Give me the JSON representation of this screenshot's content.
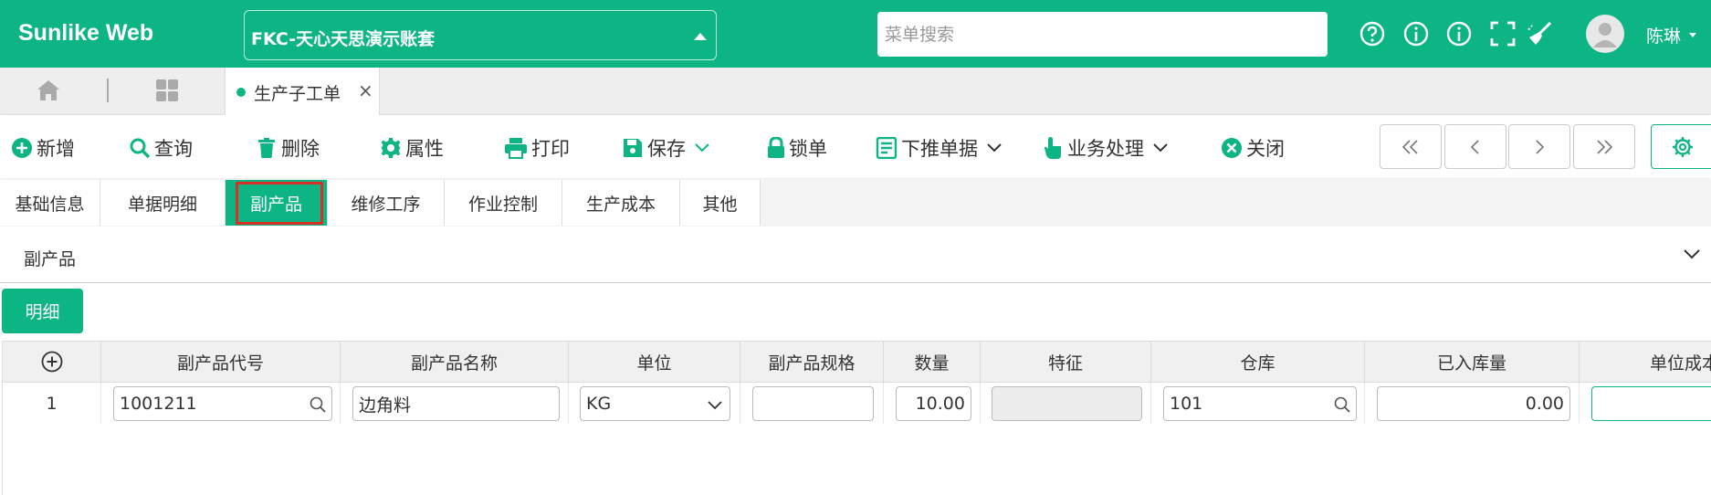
{
  "header": {
    "brand": "Sunlike Web",
    "account": "FKC-天心天思演示账套",
    "search_placeholder": "菜单搜索",
    "icons": [
      "help-icon",
      "info-icon",
      "info-icon",
      "fullscreen-icon",
      "broom-icon"
    ],
    "user": "陈琳"
  },
  "tabs": {
    "open": "生产子工单"
  },
  "toolbar": {
    "add": "新增",
    "query": "查询",
    "delete": "删除",
    "properties": "属性",
    "print": "打印",
    "save": "保存",
    "lock": "锁单",
    "push_down": "下推单据",
    "business": "业务处理",
    "close": "关闭"
  },
  "subtabs": [
    "基础信息",
    "单据明细",
    "副产品",
    "维修工序",
    "作业控制",
    "生产成本",
    "其他"
  ],
  "active_subtab": "副产品",
  "section": {
    "title": "副产品",
    "detail_button": "明细"
  },
  "table": {
    "columns": [
      "副产品代号",
      "副产品名称",
      "单位",
      "副产品规格",
      "数量",
      "特征",
      "仓库",
      "已入库量",
      "单位成本"
    ],
    "rows": [
      {
        "index": "1",
        "code": "1001211",
        "name": "边角料",
        "unit": "KG",
        "spec": "",
        "qty": "10.00",
        "feature": "",
        "warehouse": "101",
        "stocked_qty": "0.00",
        "unit_cost": ""
      }
    ]
  },
  "colors": {
    "brand": "#0db585",
    "highlight": "#d93025"
  }
}
